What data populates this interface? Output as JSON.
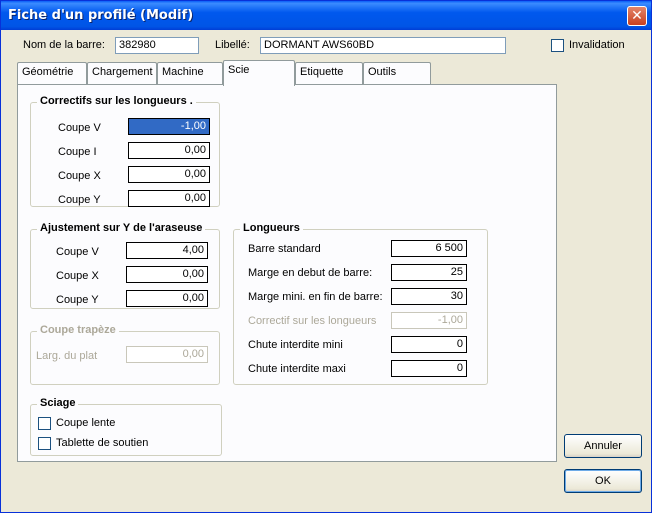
{
  "window": {
    "title": "Fiche d'un profilé (Modif)",
    "close_icon": "close-icon"
  },
  "header": {
    "nom_label": "Nom de la barre:",
    "nom_value": "382980",
    "libelle_label": "Libellé:",
    "libelle_value": "DORMANT  AWS60BD",
    "invalidation_label": "Invalidation"
  },
  "tabs": [
    {
      "label": "Géométrie"
    },
    {
      "label": "Chargement"
    },
    {
      "label": "Machine"
    },
    {
      "label": "Scie"
    },
    {
      "label": "Etiquette"
    },
    {
      "label": "Outils"
    }
  ],
  "correctifs": {
    "title": "Correctifs sur les longueurs .",
    "rows": [
      {
        "label": "Coupe V",
        "value": "-1,00"
      },
      {
        "label": "Coupe I",
        "value": "0,00"
      },
      {
        "label": "Coupe X",
        "value": "0,00"
      },
      {
        "label": "Coupe Y",
        "value": "0,00"
      }
    ]
  },
  "ajustement": {
    "title": "Ajustement sur Y de l'araseuse",
    "rows": [
      {
        "label": "Coupe V",
        "value": "4,00"
      },
      {
        "label": "Coupe X",
        "value": "0,00"
      },
      {
        "label": "Coupe Y",
        "value": "0,00"
      }
    ]
  },
  "trapeze": {
    "title": "Coupe trapèze",
    "label": "Larg. du plat",
    "value": "0,00"
  },
  "sciage": {
    "title": "Sciage",
    "options": [
      {
        "label": "Coupe lente"
      },
      {
        "label": "Tablette de soutien"
      }
    ]
  },
  "longueurs": {
    "title": "Longueurs",
    "rows": [
      {
        "label": "Barre standard",
        "value": "6 500"
      },
      {
        "label": "Marge en debut de barre:",
        "value": "25"
      },
      {
        "label": "Marge mini. en fin de barre:",
        "value": "30"
      },
      {
        "label": "Correctif sur les longueurs",
        "value": "-1,00"
      },
      {
        "label": "Chute interdite mini",
        "value": "0"
      },
      {
        "label": "Chute interdite maxi",
        "value": "0"
      }
    ]
  },
  "buttons": {
    "annuler": "Annuler",
    "ok": "OK"
  }
}
